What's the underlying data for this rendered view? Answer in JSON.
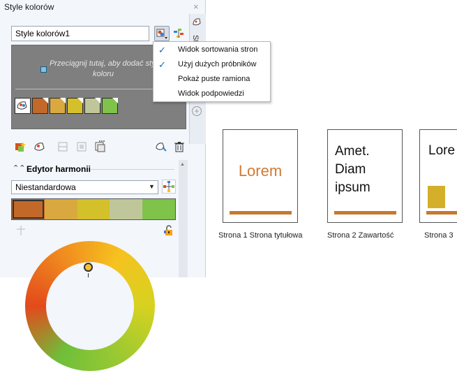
{
  "docker": {
    "title": "Style kolorów",
    "close": "×",
    "side_tab": "St",
    "style_name": "Style kolorów1",
    "drop_hint": "Przeciągnij tutaj, aby dodać styl koloru",
    "swatches": [
      "#c2692a",
      "#d9a93f",
      "#d4c02a",
      "#bfc79a",
      "#7fc34b"
    ],
    "harmony": {
      "title": "Edytor harmonii",
      "selected": "Niestandardowa",
      "colors": [
        "#c2692a",
        "#d9a93f",
        "#d4c02a",
        "#bfc79a",
        "#7fc34b"
      ]
    }
  },
  "menu": {
    "items": [
      {
        "label": "Widok sortowania stron",
        "checked": true
      },
      {
        "label": "Użyj dużych próbników",
        "checked": true
      },
      {
        "label": "Pokaż puste ramiona",
        "checked": false
      },
      {
        "label": "Widok podpowiedzi",
        "checked": false
      }
    ],
    "check_glyph": "✓"
  },
  "pages": [
    {
      "label": "Strona 1 Strona tytułowa",
      "text": "Lorem"
    },
    {
      "label": "Strona 2 Zawartość",
      "lines": [
        "Amet.",
        "Diam",
        "ipsum"
      ]
    },
    {
      "label": "Strona 3",
      "text": "Lore"
    }
  ],
  "colors": {
    "accent": "#c8782f",
    "page1_text": "#d07a33"
  }
}
